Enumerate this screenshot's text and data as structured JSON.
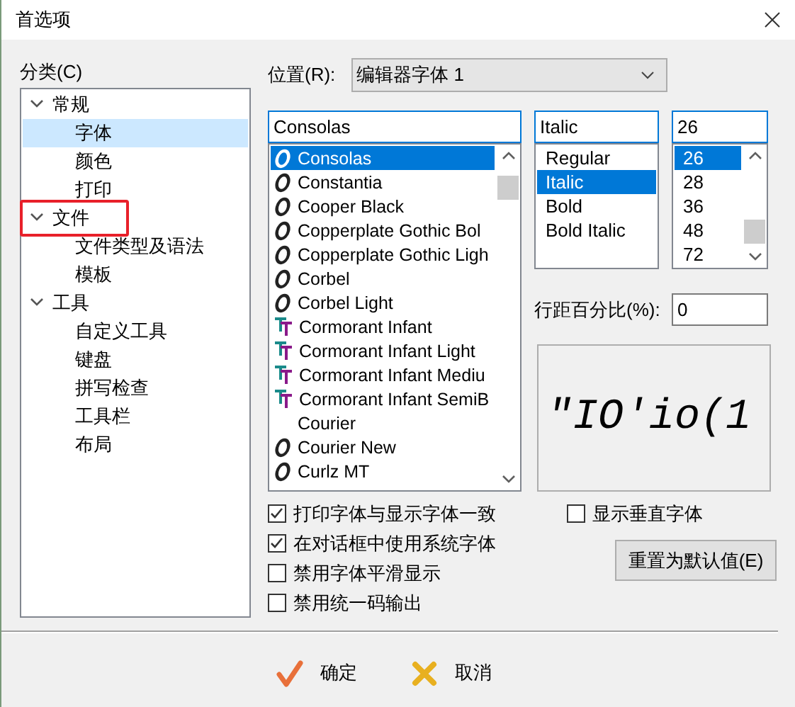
{
  "window": {
    "title": "首选项"
  },
  "category": {
    "label": "分类(C)",
    "tree": [
      {
        "label": "常规",
        "expanded": true,
        "selected": false,
        "highlighted": false,
        "children": [
          {
            "label": "字体",
            "selected": true
          },
          {
            "label": "颜色",
            "selected": false
          },
          {
            "label": "打印",
            "selected": false
          }
        ]
      },
      {
        "label": "文件",
        "expanded": true,
        "selected": false,
        "highlighted": true,
        "children": [
          {
            "label": "文件类型及语法",
            "selected": false
          },
          {
            "label": "模板",
            "selected": false
          }
        ]
      },
      {
        "label": "工具",
        "expanded": true,
        "selected": false,
        "highlighted": false,
        "children": [
          {
            "label": "自定义工具",
            "selected": false
          },
          {
            "label": "键盘",
            "selected": false
          },
          {
            "label": "拼写检查",
            "selected": false
          },
          {
            "label": "工具栏",
            "selected": false
          },
          {
            "label": "布局",
            "selected": false
          }
        ]
      }
    ]
  },
  "location": {
    "label": "位置(R):",
    "value": "编辑器字体 1"
  },
  "font": {
    "value": "Consolas",
    "items": [
      {
        "name": "Consolas",
        "kind": "opentype",
        "selected": true
      },
      {
        "name": "Constantia",
        "kind": "opentype",
        "selected": false
      },
      {
        "name": "Cooper Black",
        "kind": "opentype",
        "selected": false
      },
      {
        "name": "Copperplate Gothic Bol",
        "kind": "opentype",
        "selected": false
      },
      {
        "name": "Copperplate Gothic Ligh",
        "kind": "opentype",
        "selected": false
      },
      {
        "name": "Corbel",
        "kind": "opentype",
        "selected": false
      },
      {
        "name": "Corbel Light",
        "kind": "opentype",
        "selected": false
      },
      {
        "name": "Cormorant Infant",
        "kind": "truetype",
        "selected": false
      },
      {
        "name": "Cormorant Infant Light",
        "kind": "truetype",
        "selected": false
      },
      {
        "name": "Cormorant Infant Mediu",
        "kind": "truetype",
        "selected": false
      },
      {
        "name": "Cormorant Infant SemiB",
        "kind": "truetype",
        "selected": false
      },
      {
        "name": "Courier",
        "kind": "raster",
        "selected": false
      },
      {
        "name": "Courier New",
        "kind": "opentype",
        "selected": false
      },
      {
        "name": "Curlz MT",
        "kind": "opentype",
        "selected": false
      }
    ]
  },
  "style": {
    "value": "Italic",
    "items": [
      {
        "label": "Regular",
        "selected": false
      },
      {
        "label": "Italic",
        "selected": true
      },
      {
        "label": "Bold",
        "selected": false
      },
      {
        "label": "Bold Italic",
        "selected": false
      }
    ]
  },
  "size": {
    "value": "26",
    "items": [
      {
        "label": "26",
        "selected": true
      },
      {
        "label": "28",
        "selected": false
      },
      {
        "label": "36",
        "selected": false
      },
      {
        "label": "48",
        "selected": false
      },
      {
        "label": "72",
        "selected": false
      }
    ]
  },
  "line_spacing": {
    "label": "行距百分比(%):",
    "value": "0"
  },
  "preview": {
    "text": "\"IO'io(1"
  },
  "options": [
    {
      "label": "打印字体与显示字体一致",
      "checked": true
    },
    {
      "label": "在对话框中使用系统字体",
      "checked": true
    },
    {
      "label": "禁用字体平滑显示",
      "checked": false
    },
    {
      "label": "禁用统一码输出",
      "checked": false
    }
  ],
  "vertical_font": {
    "label": "显示垂直字体",
    "checked": false
  },
  "reset_button": "重置为默认值(E)",
  "buttons": [
    {
      "label": "确定",
      "kind": "ok"
    },
    {
      "label": "取消",
      "kind": "cancel"
    }
  ]
}
